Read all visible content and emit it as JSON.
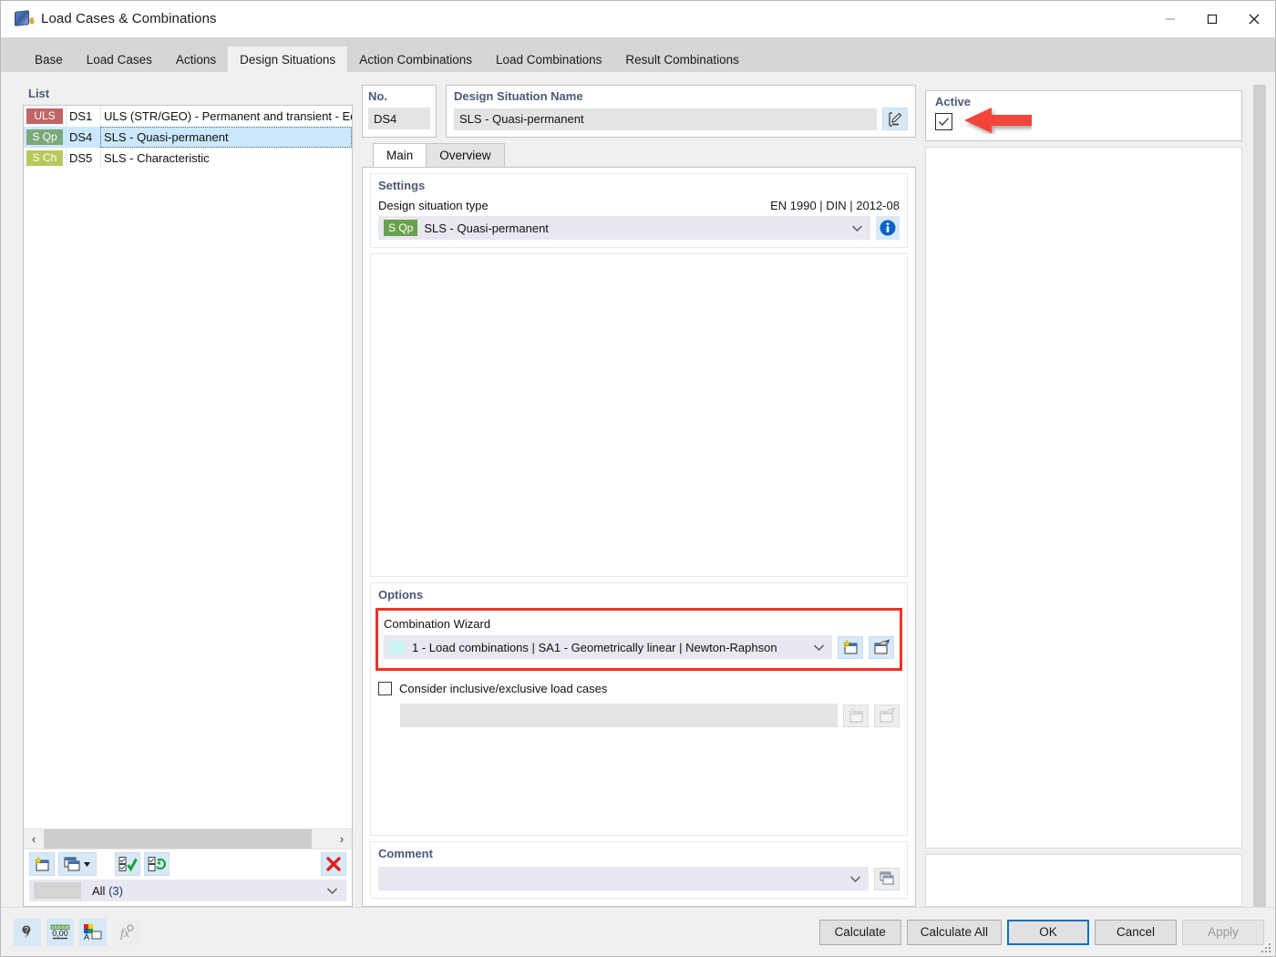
{
  "window": {
    "title": "Load Cases & Combinations",
    "icon": "rfem-cube-icon",
    "controls": {
      "minimize": "–",
      "maximize": "□",
      "close": "✕"
    }
  },
  "tabs": [
    {
      "label": "Base",
      "active": false
    },
    {
      "label": "Load Cases",
      "active": false
    },
    {
      "label": "Actions",
      "active": false
    },
    {
      "label": "Design Situations",
      "active": true
    },
    {
      "label": "Action Combinations",
      "active": false
    },
    {
      "label": "Load Combinations",
      "active": false
    },
    {
      "label": "Result Combinations",
      "active": false
    }
  ],
  "list": {
    "heading": "List",
    "rows": [
      {
        "badge": "ULS",
        "badge_color": "#c26564",
        "no": "DS1",
        "name": "ULS (STR/GEO) - Permanent and transient - Eq.",
        "selected": false
      },
      {
        "badge": "S Qp",
        "badge_color": "#7ba87b",
        "no": "DS4",
        "name": "SLS - Quasi-permanent",
        "selected": true
      },
      {
        "badge": "S Ch",
        "badge_color": "#b7c95c",
        "no": "DS5",
        "name": "SLS - Characteristic",
        "selected": false
      }
    ],
    "scroll": {
      "left_arrow": "‹",
      "right_arrow": "›"
    },
    "toolbar": [
      {
        "name": "new-design-situation-button",
        "icon": "new-window-star-icon"
      },
      {
        "name": "copy-design-situation-button",
        "icon": "copy-windows-dropdown-icon"
      },
      {
        "name": "select-all-button",
        "icon": "check-all-icon"
      },
      {
        "name": "invert-selection-button",
        "icon": "invert-selection-icon"
      },
      {
        "name": "delete-button",
        "icon": "red-x-icon"
      }
    ],
    "filter": {
      "value": "All",
      "count": "(3)",
      "caret": "⌄"
    }
  },
  "number": {
    "heading": "No.",
    "value": "DS4"
  },
  "situation_name": {
    "heading": "Design Situation Name",
    "value": "SLS - Quasi-permanent",
    "edit_icon": "rename-pencil-icon"
  },
  "active": {
    "heading": "Active",
    "checked": true,
    "check_glyph": "✓",
    "annotation_color": "#f4453a"
  },
  "inner_tabs": [
    {
      "label": "Main",
      "active": true
    },
    {
      "label": "Overview",
      "active": false
    }
  ],
  "settings": {
    "title": "Settings",
    "field_label": "Design situation type",
    "standard": "EN 1990 | DIN | 2012-08",
    "badge": "S Qp",
    "badge_color": "#6ba04e",
    "value": "SLS - Quasi-permanent",
    "caret": "⌄",
    "info_icon": "info-circle-icon"
  },
  "options": {
    "title": "Options",
    "wizard_label": "Combination Wizard",
    "wizard_value": "1 - Load combinations | SA1 - Geometrically linear | Newton-Raphson",
    "wizard_caret": "⌄",
    "wizard_new_icon": "new-wizard-star-icon",
    "wizard_edit_icon": "edit-wizard-icon",
    "highlight_color": "#ee3322",
    "inclusive_checkbox_label": "Consider inclusive/exclusive load cases",
    "inclusive_checked": false,
    "inclusive_value": "",
    "inclusive_new_icon": "new-wizard-star-icon",
    "inclusive_edit_icon": "edit-wizard-icon"
  },
  "comment": {
    "title": "Comment",
    "value": "",
    "caret": "⌄",
    "browse_icon": "comment-library-icon"
  },
  "footer": {
    "tools": [
      {
        "name": "help-button",
        "icon": "question-magnifier-icon",
        "enabled": true
      },
      {
        "name": "units-button",
        "icon": "units-ruler-icon",
        "enabled": true
      },
      {
        "name": "display-properties-button",
        "icon": "colors-properties-icon",
        "enabled": true
      },
      {
        "name": "formula-button",
        "icon": "fx-formula-icon",
        "enabled": false
      }
    ],
    "buttons": [
      {
        "label": "Calculate",
        "style": "normal"
      },
      {
        "label": "Calculate All",
        "style": "normal"
      },
      {
        "label": "OK",
        "style": "default"
      },
      {
        "label": "Cancel",
        "style": "normal"
      },
      {
        "label": "Apply",
        "style": "disabled"
      }
    ]
  }
}
